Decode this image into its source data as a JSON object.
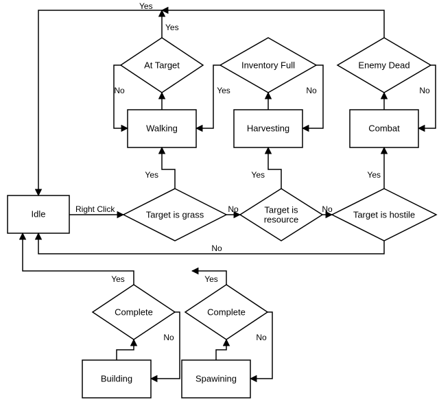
{
  "nodes": {
    "idle": "Idle",
    "walking": "Walking",
    "harvesting": "Harvesting",
    "combat": "Combat",
    "building": "Building",
    "spawning": "Spawining",
    "at_target": "At Target",
    "inv_full": "Inventory Full",
    "enemy_dead": "Enemy Dead",
    "t_grass": "Target is grass",
    "t_resource1": "Target is",
    "t_resource2": "resource",
    "t_hostile": "Target is hostile",
    "complete1": "Complete",
    "complete2": "Complete"
  },
  "edges": {
    "yes": "Yes",
    "no": "No",
    "right_click": "Right Click"
  }
}
